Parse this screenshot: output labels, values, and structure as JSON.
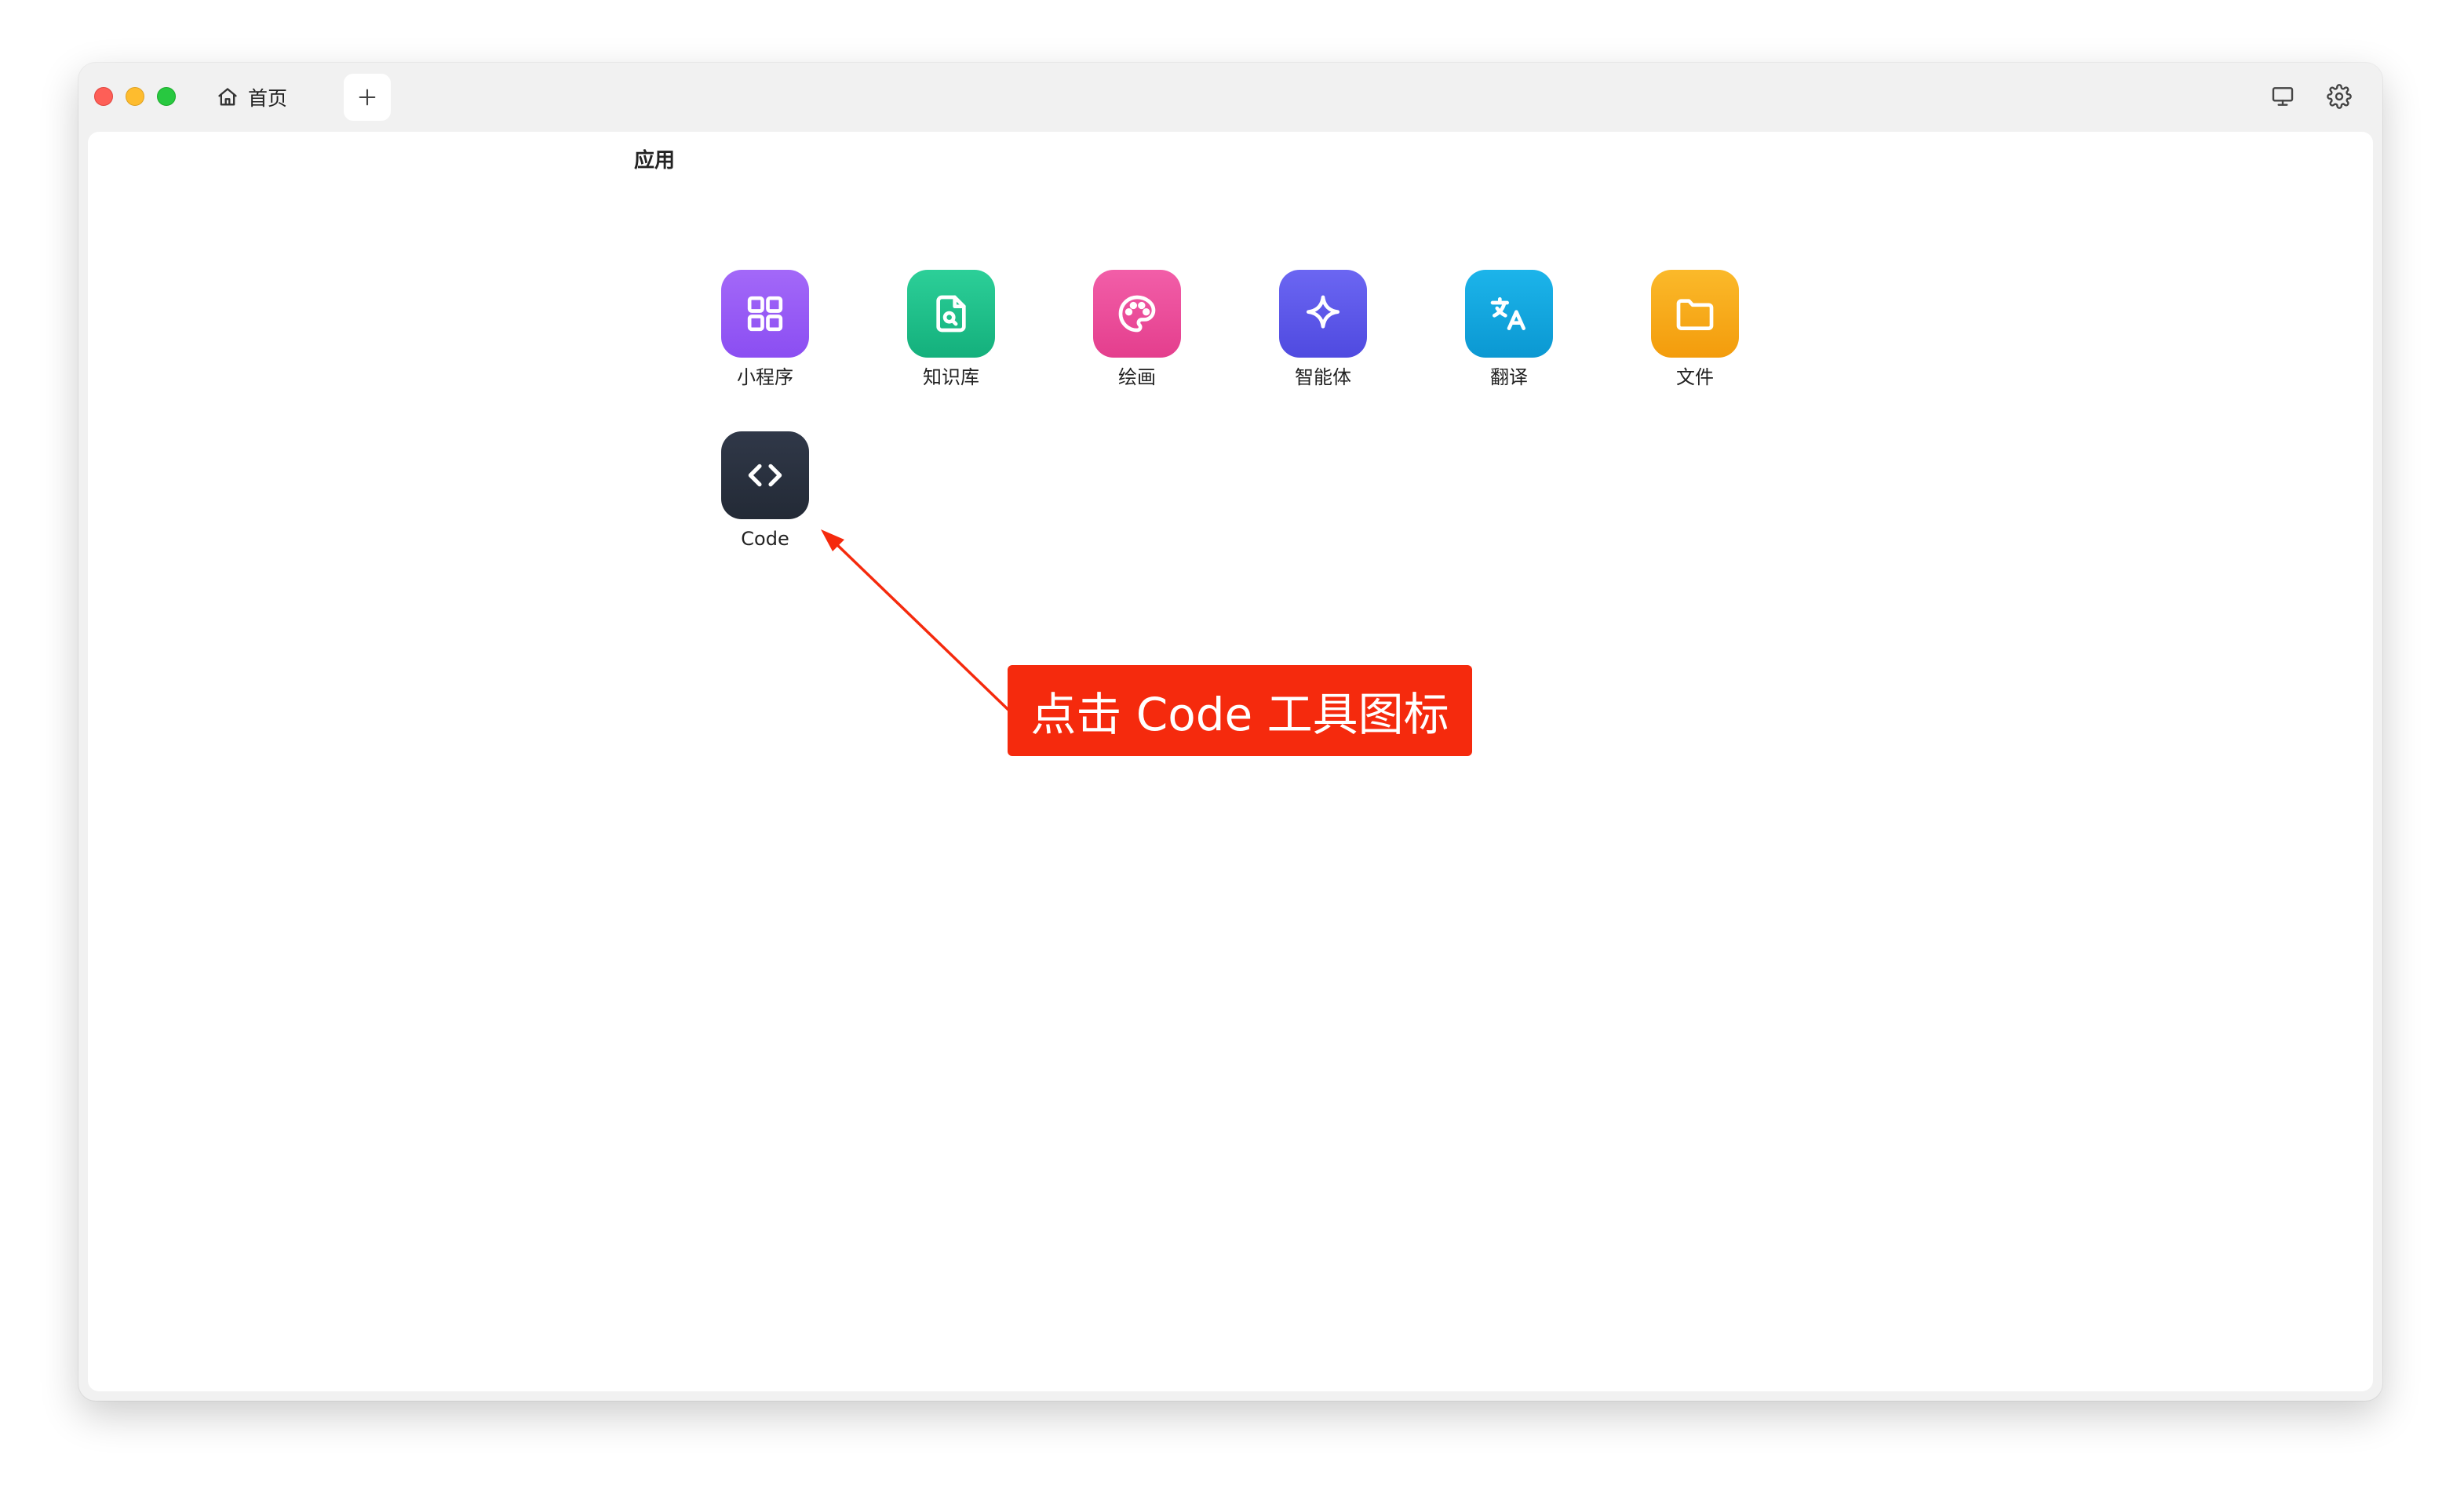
{
  "titlebar": {
    "tab_label": "首页"
  },
  "main": {
    "section_title": "应用",
    "apps": [
      {
        "label": "小程序",
        "icon": "grid-icon",
        "color": "#9b5cf6"
      },
      {
        "label": "知识库",
        "icon": "file-search-icon",
        "color": "#1fbf8a"
      },
      {
        "label": "绘画",
        "icon": "palette-icon",
        "color": "#ec4d9a"
      },
      {
        "label": "智能体",
        "icon": "sparkle-icon",
        "color": "#5b57e8"
      },
      {
        "label": "翻译",
        "icon": "translate-icon",
        "color": "#12a8e0"
      },
      {
        "label": "文件",
        "icon": "folder-icon",
        "color": "#f7aa10"
      },
      {
        "label": "Code",
        "icon": "code-icon",
        "color": "#2a3140"
      }
    ]
  },
  "annotation": {
    "text": "点击 Code 工具图标",
    "color": "#f52a0d"
  }
}
